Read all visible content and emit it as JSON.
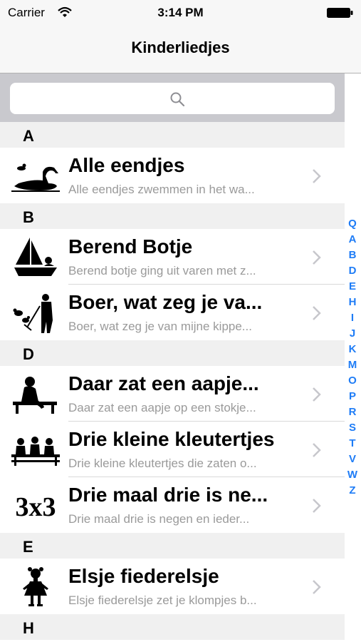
{
  "status_bar": {
    "carrier": "Carrier",
    "time": "3:14 PM"
  },
  "nav": {
    "title": "Kinderliedjes"
  },
  "search": {
    "icon": "magnifier-icon"
  },
  "sections": [
    {
      "letter": "A",
      "rows": [
        {
          "icon": "ducks-icon",
          "title": "Alle eendjes",
          "subtitle": "Alle eendjes zwemmen in het wa..."
        }
      ]
    },
    {
      "letter": "B",
      "rows": [
        {
          "icon": "sailboat-icon",
          "title": "Berend Botje",
          "subtitle": "Berend botje ging uit varen met z..."
        },
        {
          "icon": "farmer-chickens-icon",
          "title": "Boer, wat zeg je va...",
          "subtitle": "Boer, wat zeg je van mijne kippe..."
        }
      ]
    },
    {
      "letter": "D",
      "rows": [
        {
          "icon": "monkey-on-stick-icon",
          "title": "Daar zat een aapje...",
          "subtitle": "Daar zat een aapje op een stokje..."
        },
        {
          "icon": "three-toddlers-bench-icon",
          "title": "Drie kleine kleutertjes",
          "subtitle": "Drie kleine kleutertjes die zaten o..."
        },
        {
          "icon": "three-times-three-icon",
          "title": "Drie maal drie is ne...",
          "subtitle": "Drie maal drie is negen en ieder..."
        }
      ]
    },
    {
      "letter": "E",
      "rows": [
        {
          "icon": "dancing-girl-icon",
          "title": "Elsje fiederelsje",
          "subtitle": "Elsje fiederelsje zet je klompjes b..."
        }
      ]
    },
    {
      "letter": "H",
      "rows": []
    }
  ],
  "index": [
    "Q",
    "A",
    "B",
    "D",
    "E",
    "H",
    "I",
    "J",
    "K",
    "M",
    "O",
    "P",
    "R",
    "S",
    "T",
    "V",
    "W",
    "Z"
  ],
  "thumb_texts": {
    "three_times_three": "3x3"
  },
  "colors": {
    "index_blue": "#1e7cf6",
    "section_bg": "#f0f0f0",
    "search_bg": "#c9c9ce"
  }
}
